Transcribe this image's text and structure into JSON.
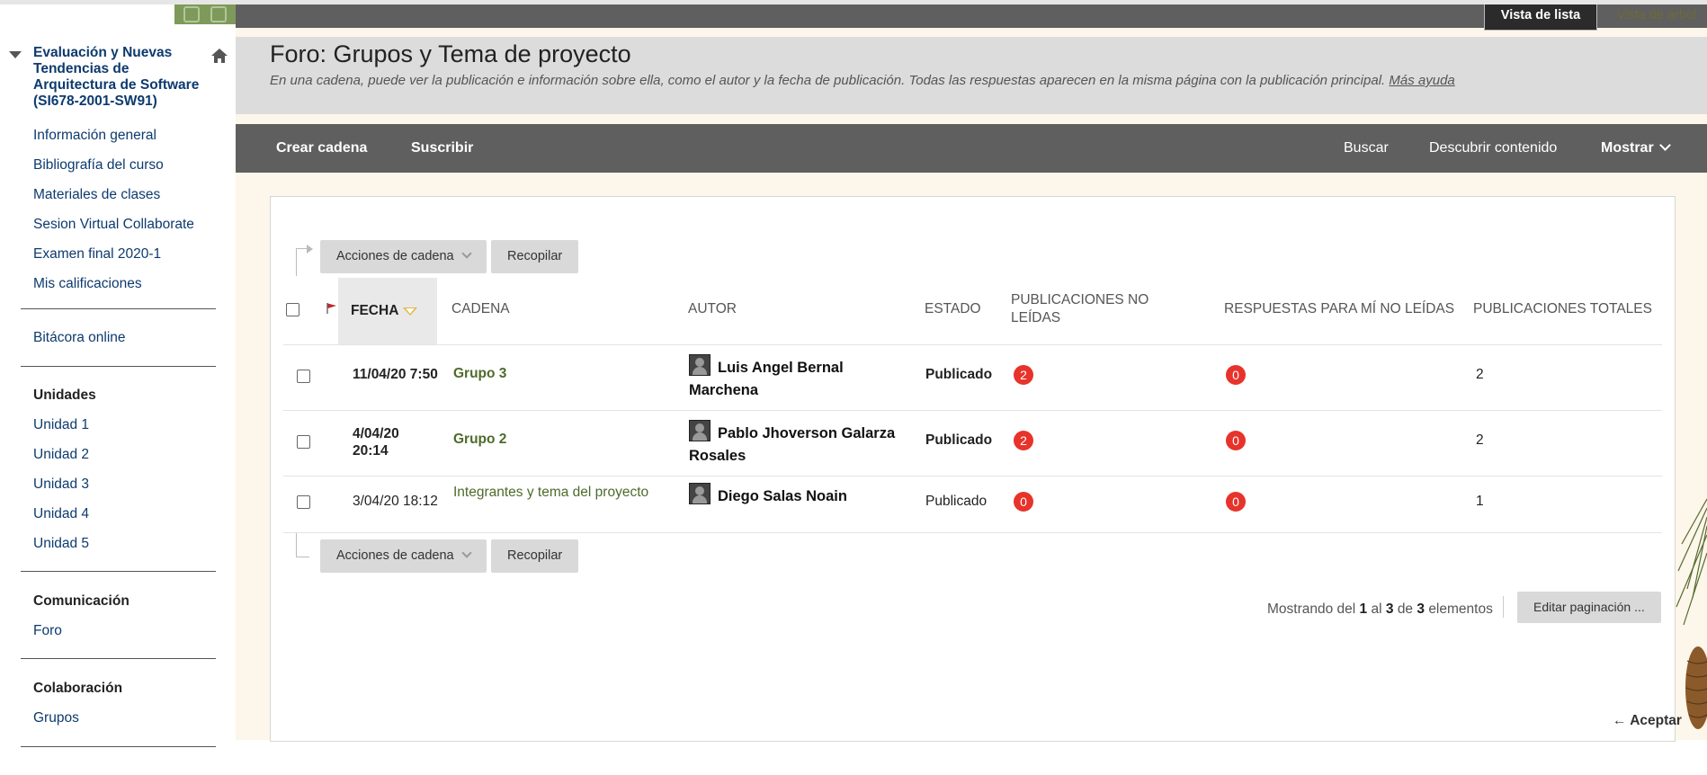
{
  "sidebar": {
    "course_title": "Evaluación y Nuevas Tendencias de Arquitectura de Software (SI678-2001-SW91)",
    "links": [
      "Información general",
      "Bibliografía del curso",
      "Materiales de clases",
      "Sesion Virtual Collaborate",
      "Examen final 2020-1",
      "Mis calificaciones"
    ],
    "bitacora": "Bitácora online",
    "unidades_head": "Unidades",
    "unidades": [
      "Unidad 1",
      "Unidad 2",
      "Unidad 3",
      "Unidad 4",
      "Unidad 5"
    ],
    "comunicacion_head": "Comunicación",
    "foro": "Foro",
    "colaboracion_head": "Colaboración",
    "grupos": "Grupos"
  },
  "view_tabs": {
    "list": "Vista de lista",
    "tree": "Vista de árbol"
  },
  "header": {
    "title": "Foro: Grupos y Tema de proyecto",
    "subtitle": "En una cadena, puede ver la publicación e información sobre ella, como el autor y la fecha de publicación. Todas las respuestas aparecen en la misma página con la publicación principal.",
    "help_link": "Más ayuda"
  },
  "action_bar": {
    "create": "Crear cadena",
    "subscribe": "Suscribir",
    "search": "Buscar",
    "discover": "Descubrir contenido",
    "show": "Mostrar"
  },
  "toolbar": {
    "thread_actions": "Acciones de cadena",
    "collect": "Recopilar"
  },
  "columns": {
    "fecha": "FECHA",
    "cadena": "CADENA",
    "autor": "AUTOR",
    "estado": "ESTADO",
    "no_leidas": "PUBLICACIONES NO LEÍDAS",
    "respuestas": "RESPUESTAS PARA MÍ NO LEÍDAS",
    "totales": "PUBLICACIONES TOTALES"
  },
  "rows": [
    {
      "fecha": "11/04/20 7:50",
      "cadena": "Grupo 3",
      "autor": "Luis Angel Bernal Marchena",
      "estado": "Publicado",
      "no_leidas": "2",
      "respuestas": "0",
      "totales": "2"
    },
    {
      "fecha": "4/04/20 20:14",
      "cadena": "Grupo 2",
      "autor": "Pablo Jhoverson Galarza Rosales",
      "estado": "Publicado",
      "no_leidas": "2",
      "respuestas": "0",
      "totales": "2"
    },
    {
      "fecha": "3/04/20 18:12",
      "cadena": "Integrantes y tema del proyecto",
      "autor": "Diego Salas Noain",
      "estado": "Publicado",
      "no_leidas": "0",
      "respuestas": "0",
      "totales": "1"
    }
  ],
  "paging": {
    "prefix": "Mostrando del",
    "from": "1",
    "al": "al",
    "to": "3",
    "de": "de",
    "total": "3",
    "suffix": "elementos",
    "edit": "Editar paginación ..."
  },
  "aceptar": "← Aceptar",
  "colors": {
    "badge": "#e7332b",
    "link_green": "#4e6a2b",
    "sidebar_link": "#0d3a6e",
    "bar_gray": "#5f5f5f"
  }
}
